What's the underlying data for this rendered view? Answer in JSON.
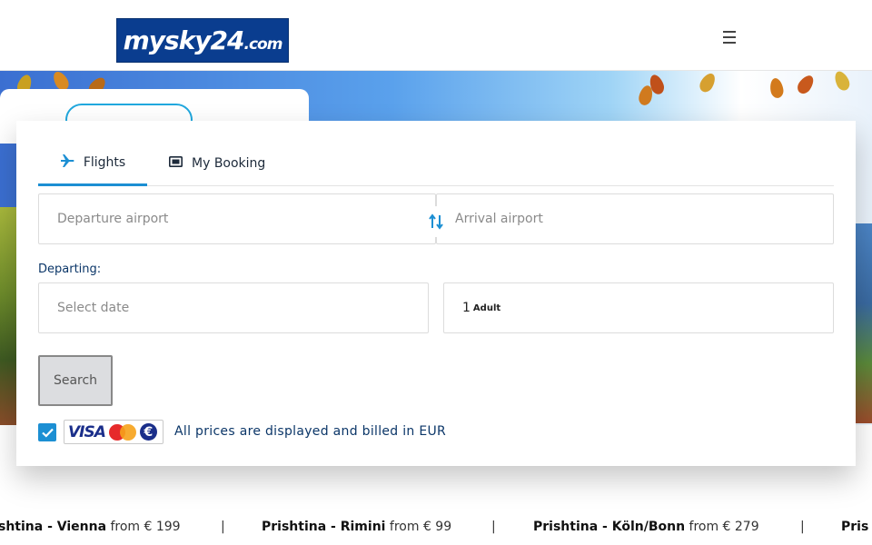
{
  "header": {
    "logo": {
      "name": "mysky24",
      "tld": ".com"
    },
    "menu_icon": "hamburger-menu-icon"
  },
  "booking": {
    "tabs": [
      {
        "label": "Flights",
        "icon": "airplane-icon",
        "active": true
      },
      {
        "label": "My Booking",
        "icon": "ticket-icon",
        "active": false
      }
    ],
    "departure_placeholder": "Departure airport",
    "arrival_placeholder": "Arrival airport",
    "swap_icon": "swap-arrows-icon",
    "departing_label": "Departing:",
    "date_placeholder": "Select date",
    "passengers": {
      "count": "1",
      "type": "Adult"
    },
    "search_label": "Search",
    "payment": {
      "checked": true,
      "cards": [
        "VISA",
        "MasterCard",
        "€"
      ],
      "note": "All prices are displayed and billed in EUR"
    }
  },
  "ticker": {
    "items": [
      {
        "route": "shtina - Vienna",
        "from": "from € 199"
      },
      {
        "route": "Prishtina - Rimini",
        "from": "from € 99"
      },
      {
        "route": "Prishtina - Köln/Bonn",
        "from": "from € 279"
      },
      {
        "route": "Pris",
        "from": ""
      }
    ],
    "separator": "|"
  },
  "colors": {
    "accent": "#1c8fd3",
    "logo_bg": "#0a3d8f",
    "text_dark": "#0b3668"
  }
}
